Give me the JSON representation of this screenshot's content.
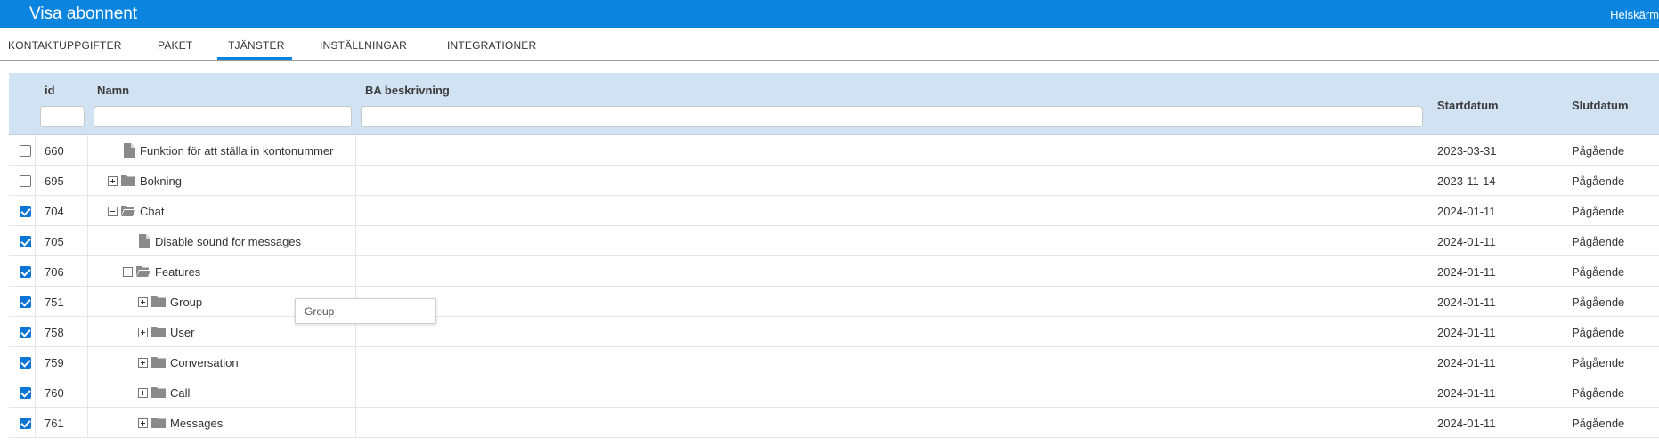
{
  "window": {
    "title": "Visa abonnent",
    "fullscreen_label": "Helskärm"
  },
  "tabs": [
    {
      "label": "KONTAKTUPPGIFTER",
      "active": false
    },
    {
      "label": "PAKET",
      "active": false
    },
    {
      "label": "TJÄNSTER",
      "active": true
    },
    {
      "label": "INSTÄLLNINGAR",
      "active": false
    },
    {
      "label": "INTEGRATIONER",
      "active": false
    }
  ],
  "grid": {
    "columns": {
      "id": "id",
      "name": "Namn",
      "description": "BA beskrivning",
      "start": "Startdatum",
      "end": "Slutdatum"
    },
    "rows": [
      {
        "checked": false,
        "id": "660",
        "name": "Funktion för att ställa in kontonummer",
        "type": "file",
        "level": 1,
        "toggle": "none",
        "start": "2023-03-31",
        "end": "Pågående"
      },
      {
        "checked": false,
        "id": "695",
        "name": "Bokning",
        "type": "folder",
        "level": 1,
        "toggle": "plus",
        "start": "2023-11-14",
        "end": "Pågående"
      },
      {
        "checked": true,
        "id": "704",
        "name": "Chat",
        "type": "folder-open",
        "level": 1,
        "toggle": "minus",
        "start": "2024-01-11",
        "end": "Pågående"
      },
      {
        "checked": true,
        "id": "705",
        "name": "Disable sound for messages",
        "type": "file",
        "level": 2,
        "toggle": "none",
        "start": "2024-01-11",
        "end": "Pågående"
      },
      {
        "checked": true,
        "id": "706",
        "name": "Features",
        "type": "folder-open",
        "level": 2,
        "toggle": "minus",
        "start": "2024-01-11",
        "end": "Pågående"
      },
      {
        "checked": true,
        "id": "751",
        "name": "Group",
        "type": "folder",
        "level": 3,
        "toggle": "plus",
        "start": "2024-01-11",
        "end": "Pågående"
      },
      {
        "checked": true,
        "id": "758",
        "name": "User",
        "type": "folder",
        "level": 3,
        "toggle": "plus",
        "start": "2024-01-11",
        "end": "Pågående"
      },
      {
        "checked": true,
        "id": "759",
        "name": "Conversation",
        "type": "folder",
        "level": 3,
        "toggle": "plus",
        "start": "2024-01-11",
        "end": "Pågående"
      },
      {
        "checked": true,
        "id": "760",
        "name": "Call",
        "type": "folder",
        "level": 3,
        "toggle": "plus",
        "start": "2024-01-11",
        "end": "Pågående"
      },
      {
        "checked": true,
        "id": "761",
        "name": "Messages",
        "type": "folder",
        "level": 3,
        "toggle": "plus",
        "start": "2024-01-11",
        "end": "Pågående"
      }
    ]
  },
  "tooltip": {
    "text": "Group"
  },
  "colors": {
    "accent": "#0b84e0",
    "header_bg": "#d1e3f2",
    "checkbox_checked": "#0b75d6",
    "icon_gray": "#8a8a8a"
  }
}
